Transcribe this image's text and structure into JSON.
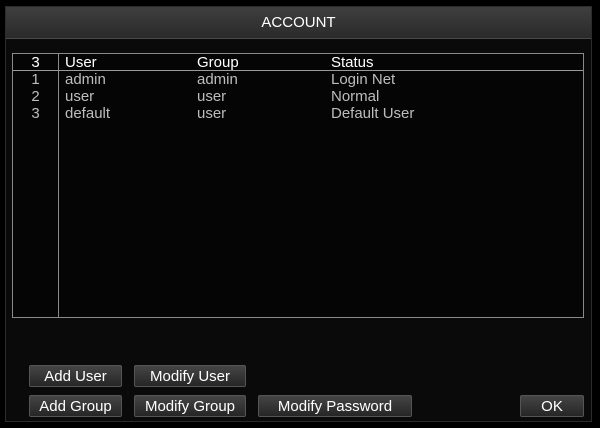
{
  "dialog": {
    "title": "ACCOUNT"
  },
  "table": {
    "headers": {
      "count": "3",
      "user": "User",
      "group": "Group",
      "status": "Status"
    },
    "rows": [
      {
        "index": "1",
        "user": "admin",
        "group": "admin",
        "status": "Login Net"
      },
      {
        "index": "2",
        "user": "user",
        "group": "user",
        "status": "Normal"
      },
      {
        "index": "3",
        "user": "default",
        "group": "user",
        "status": "Default User"
      }
    ]
  },
  "buttons": {
    "add_user": "Add User",
    "modify_user": "Modify User",
    "add_group": "Add Group",
    "modify_group": "Modify Group",
    "modify_password": "Modify Password",
    "ok": "OK"
  },
  "colors": {
    "background": "#000000",
    "text_header": "#ffffff",
    "text_rows": "#bdbdbd",
    "border": "#8a8a8a"
  }
}
